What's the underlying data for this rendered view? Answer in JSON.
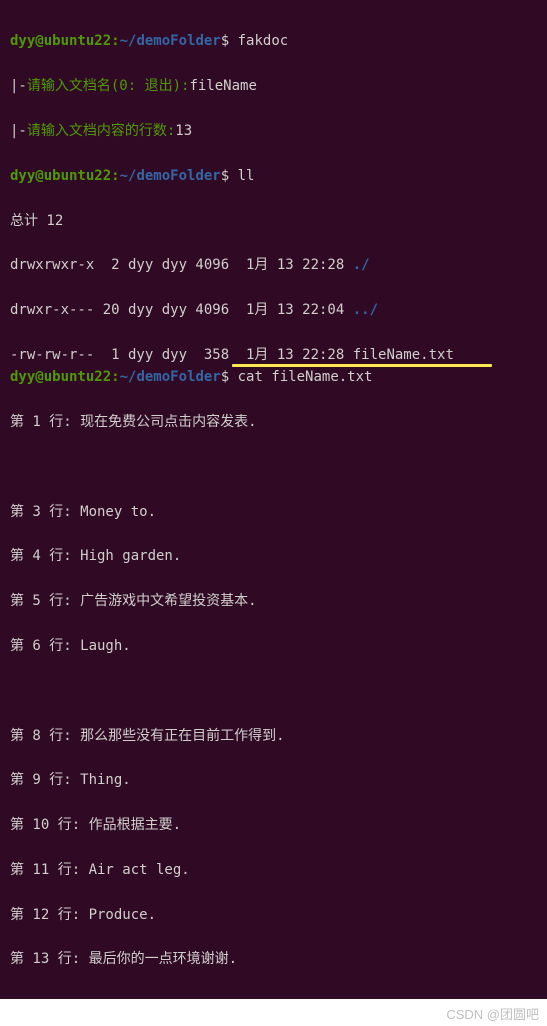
{
  "prompt": {
    "user": "dyy@ubuntu22",
    "sep1": ":",
    "path": "~/demoFolder",
    "sep2": "$ "
  },
  "cmds": {
    "c1": "fakdoc",
    "c2": "ll",
    "c3": "cat fileName.txt"
  },
  "prompts_input": {
    "bar": "|-",
    "p1_label": "请输入文档名(0: 退出):",
    "p1_val": "fileName",
    "p2_label": "请输入文档内容的行数:",
    "p2_val": "13"
  },
  "ls": {
    "total": "总计 12",
    "r1_perm": "drwxrwxr-x  2 dyy dyy 4096  1月 13 22:28 ",
    "r1_name": "./",
    "r2_perm": "drwxr-x--- 20 dyy dyy 4096  1月 13 22:04 ",
    "r2_name": "../",
    "r3_perm": "-rw-rw-r--  1 dyy dyy  358  1月 13 22:28 ",
    "r3_name": "fileName.txt"
  },
  "file_lines": {
    "l1": "第 1 行: 现在免费公司点击内容发表.",
    "blank1": "",
    "l3": "第 3 行: Money to.",
    "l4": "第 4 行: High garden.",
    "l5": "第 5 行: 广告游戏中文希望投资基本.",
    "l6": "第 6 行: Laugh.",
    "blank2": "",
    "l8": "第 8 行: 那么那些没有正在目前工作得到.",
    "l9": "第 9 行: Thing.",
    "l10": "第 10 行: 作品根据主要.",
    "l11": "第 11 行: Air act leg.",
    "l12": "第 12 行: Produce.",
    "l13": "第 13 行: 最后你的一点环境谢谢."
  },
  "watermark": "CSDN @团圆吧"
}
